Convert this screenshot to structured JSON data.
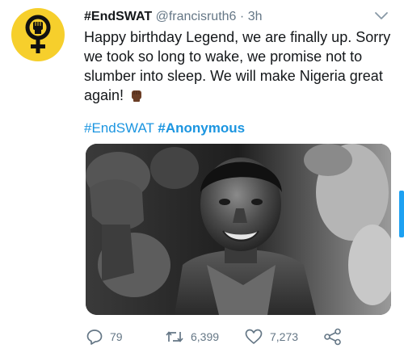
{
  "tweet": {
    "display_name": "#EndSWAT",
    "handle": "@francisruth6",
    "separator": "·",
    "time": "3h",
    "text": "Happy birthday Legend, we are finally up. Sorry we took so long to wake, we promise not to slumber into sleep. We will make Nigeria great again!",
    "hashtags": [
      "#EndSWAT",
      "#Anonymous"
    ],
    "replies": "79",
    "retweets": "6,399",
    "likes": "7,273"
  },
  "icons": {
    "avatar": "female-symbol-fist-icon",
    "caret": "chevron-down-icon",
    "emoji": "raised-fist-emoji",
    "reply": "reply-icon",
    "retweet": "retweet-icon",
    "like": "heart-icon",
    "share": "share-icon"
  },
  "colors": {
    "accent": "#1b95e0",
    "muted": "#657786",
    "avatar_bg": "#f6cf2c"
  }
}
